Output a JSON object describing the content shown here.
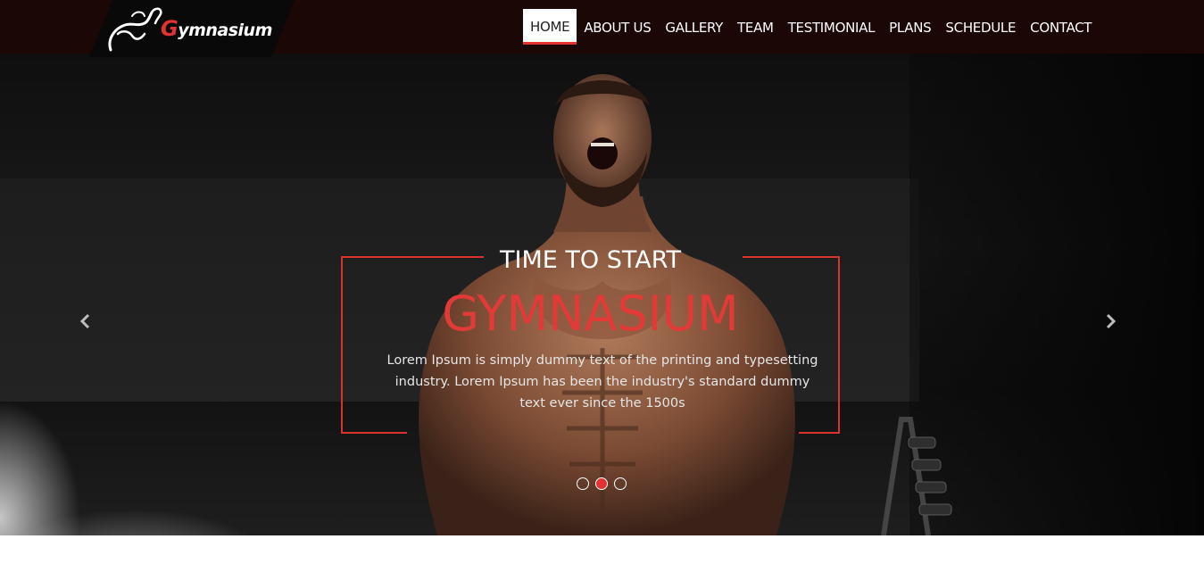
{
  "brand": {
    "logo_text": "Gymnasium",
    "logo_first_letter": "G",
    "logo_rest": "ymnasium"
  },
  "nav": {
    "items": [
      {
        "label": "HOME",
        "active": true
      },
      {
        "label": "ABOUT US"
      },
      {
        "label": "GALLERY"
      },
      {
        "label": "TEAM"
      },
      {
        "label": "TESTIMONIAL"
      },
      {
        "label": "PLANS"
      },
      {
        "label": "SCHEDULE"
      },
      {
        "label": "CONTACT"
      }
    ]
  },
  "hero": {
    "title": "TIME TO START",
    "brand": "GYMNASIUM",
    "text": "Lorem Ipsum is simply dummy text of the printing and typesetting industry. Lorem Ipsum has been the industry's standard dummy text ever since the 1500s",
    "prev_icon": "chevron-left-icon",
    "next_icon": "chevron-right-icon",
    "slides": 3,
    "active_slide": 2
  },
  "colors": {
    "header_bg": "#1c0707",
    "accent": "#e23232",
    "text": "#ffffff"
  }
}
